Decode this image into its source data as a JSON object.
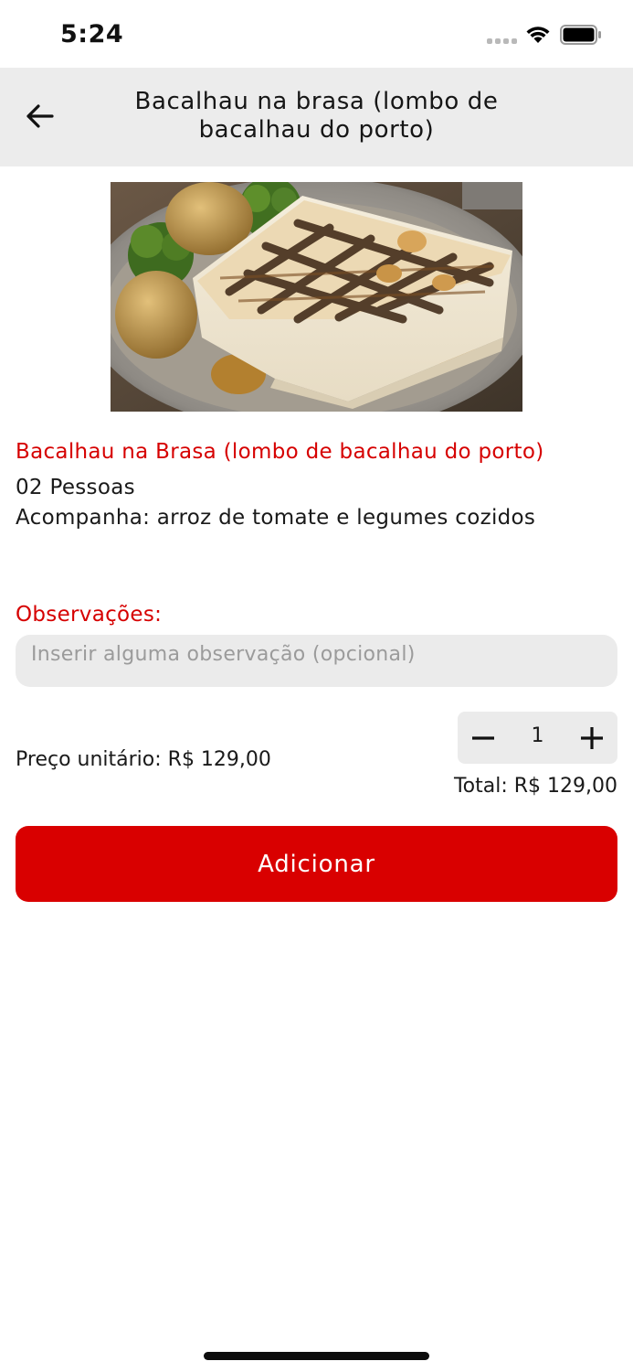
{
  "status_bar": {
    "time": "5:24",
    "icons": [
      "signal-icon",
      "wifi-icon",
      "battery-icon"
    ]
  },
  "header": {
    "back_icon": "arrow-left-icon",
    "title": "Bacalhau na brasa (lombo de bacalhau do porto)"
  },
  "product": {
    "image": "grilled-cod-photo",
    "name": "Bacalhau na Brasa (lombo de bacalhau do porto)",
    "people": "02 Pessoas",
    "side": "Acompanha: arroz de tomate e legumes cozidos"
  },
  "notes": {
    "label": "Observações:",
    "placeholder": "Inserir alguma observação (opcional)",
    "value": ""
  },
  "pricing": {
    "unit_price": "Preço unitário: R$ 129,00",
    "total": "Total: R$ 129,00"
  },
  "quantity": {
    "value": "1",
    "minus_icon": "minus-icon",
    "plus_icon": "plus-icon"
  },
  "actions": {
    "add_label": "Adicionar"
  },
  "colors": {
    "accent": "#d90000",
    "header_bg": "#ececec",
    "input_bg": "#ebebeb"
  }
}
